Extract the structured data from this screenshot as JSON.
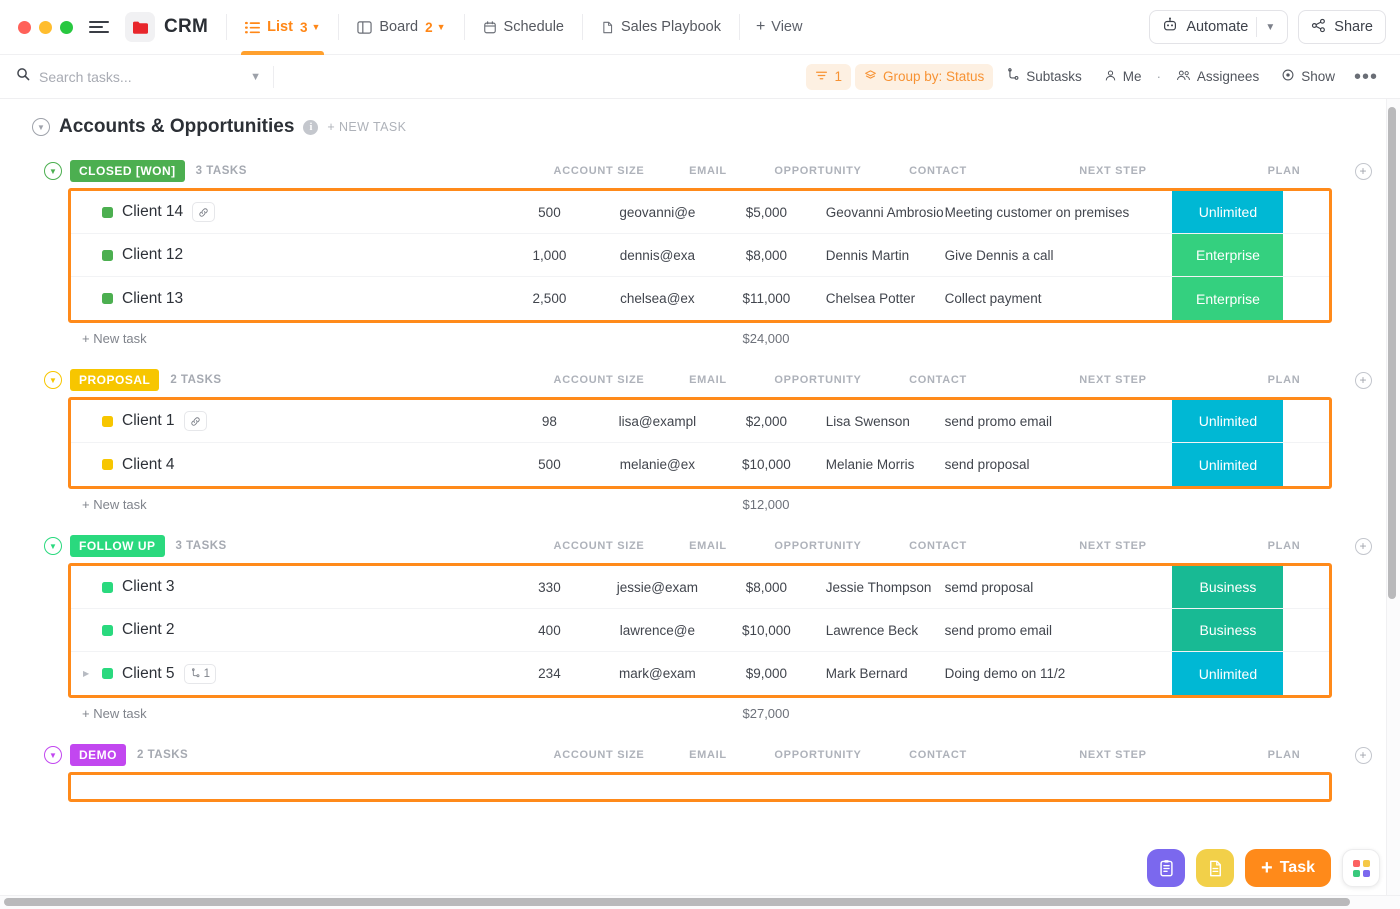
{
  "window": {
    "traffic_lights": [
      "close",
      "minimize",
      "maximize"
    ]
  },
  "header": {
    "menu_icon": "hamburger-icon",
    "logo_icon": "folder-icon",
    "app_title": "CRM",
    "tabs": [
      {
        "label": "List",
        "count": "3",
        "icon": "list-icon",
        "active": true,
        "has_caret": true
      },
      {
        "label": "Board",
        "count": "2",
        "icon": "board-icon",
        "active": false,
        "has_caret": true
      },
      {
        "label": "Schedule",
        "count": "",
        "icon": "calendar-icon",
        "active": false,
        "has_caret": false
      },
      {
        "label": "Sales Playbook",
        "count": "",
        "icon": "doc-icon",
        "active": false,
        "has_caret": false
      }
    ],
    "add_view_label": "View",
    "automate_label": "Automate",
    "share_label": "Share"
  },
  "toolbar": {
    "search_placeholder": "Search tasks...",
    "filter_count": "1",
    "group_by_label": "Group by: Status",
    "subtasks_label": "Subtasks",
    "me_label": "Me",
    "assignees_label": "Assignees",
    "show_label": "Show",
    "more_label": "•••"
  },
  "list": {
    "title": "Accounts & Opportunities",
    "new_task_label": "+ NEW TASK",
    "columns": [
      "ACCOUNT SIZE",
      "EMAIL",
      "OPPORTUNITY",
      "CONTACT",
      "NEXT STEP",
      "PLAN"
    ],
    "new_task_row_label": "+ New task"
  },
  "colors": {
    "accent_orange": "#ff8a1a",
    "closed_won": "#4caf50",
    "proposal": "#f7c600",
    "follow_up": "#2ad97e",
    "demo": "#c247f0",
    "plan_unlimited": "#00b8d4",
    "plan_enterprise": "#34d07f",
    "plan_business": "#18ba94"
  },
  "groups": [
    {
      "name": "CLOSED [WON]",
      "chip_color": "#4caf50",
      "task_count": "3 TASKS",
      "sum": "$24,000",
      "rows": [
        {
          "dot": "#4caf50",
          "name": "Client 14",
          "badge": "link-icon",
          "badge_text": "",
          "account_size": "500",
          "email": "geovanni@e",
          "opportunity": "$5,000",
          "contact": "Geovanni Ambrosio",
          "next_step": "Meeting customer on premises",
          "plan": "Unlimited",
          "plan_color": "#00b8d4"
        },
        {
          "dot": "#4caf50",
          "name": "Client 12",
          "badge": "",
          "badge_text": "",
          "account_size": "1,000",
          "email": "dennis@exa",
          "opportunity": "$8,000",
          "contact": "Dennis Martin",
          "next_step": "Give Dennis a call",
          "plan": "Enterprise",
          "plan_color": "#34d07f"
        },
        {
          "dot": "#4caf50",
          "name": "Client 13",
          "badge": "",
          "badge_text": "",
          "account_size": "2,500",
          "email": "chelsea@ex",
          "opportunity": "$11,000",
          "contact": "Chelsea Potter",
          "next_step": "Collect payment",
          "plan": "Enterprise",
          "plan_color": "#34d07f"
        }
      ]
    },
    {
      "name": "PROPOSAL",
      "chip_color": "#f7c600",
      "task_count": "2 TASKS",
      "sum": "$12,000",
      "rows": [
        {
          "dot": "#f7c600",
          "name": "Client 1",
          "badge": "link-icon",
          "badge_text": "",
          "account_size": "98",
          "email": "lisa@exampl",
          "opportunity": "$2,000",
          "contact": "Lisa Swenson",
          "next_step": "send promo email",
          "plan": "Unlimited",
          "plan_color": "#00b8d4"
        },
        {
          "dot": "#f7c600",
          "name": "Client 4",
          "badge": "",
          "badge_text": "",
          "account_size": "500",
          "email": "melanie@ex",
          "opportunity": "$10,000",
          "contact": "Melanie Morris",
          "next_step": "send proposal",
          "plan": "Unlimited",
          "plan_color": "#00b8d4"
        }
      ]
    },
    {
      "name": "FOLLOW UP",
      "chip_color": "#2ad97e",
      "task_count": "3 TASKS",
      "sum": "$27,000",
      "rows": [
        {
          "dot": "#2ad97e",
          "name": "Client 3",
          "badge": "",
          "badge_text": "",
          "account_size": "330",
          "email": "jessie@exam",
          "opportunity": "$8,000",
          "contact": "Jessie Thompson",
          "next_step": "semd proposal",
          "plan": "Business",
          "plan_color": "#18ba94"
        },
        {
          "dot": "#2ad97e",
          "name": "Client 2",
          "badge": "",
          "badge_text": "",
          "account_size": "400",
          "email": "lawrence@e",
          "opportunity": "$10,000",
          "contact": "Lawrence Beck",
          "next_step": "send promo email",
          "plan": "Business",
          "plan_color": "#18ba94"
        },
        {
          "dot": "#2ad97e",
          "name": "Client 5",
          "badge": "subtask-icon",
          "badge_text": "1",
          "account_size": "234",
          "email": "mark@exam",
          "opportunity": "$9,000",
          "contact": "Mark Bernard",
          "next_step": "Doing demo on 11/2",
          "plan": "Unlimited",
          "plan_color": "#00b8d4",
          "expandable": true
        }
      ]
    },
    {
      "name": "DEMO",
      "chip_color": "#c247f0",
      "task_count": "2 TASKS",
      "sum": "",
      "rows": []
    }
  ],
  "fabs": {
    "notepad_label": "notepad-icon",
    "docs_label": "doc-icon",
    "task_label": "Task",
    "apps_label": "apps-grid-icon"
  }
}
